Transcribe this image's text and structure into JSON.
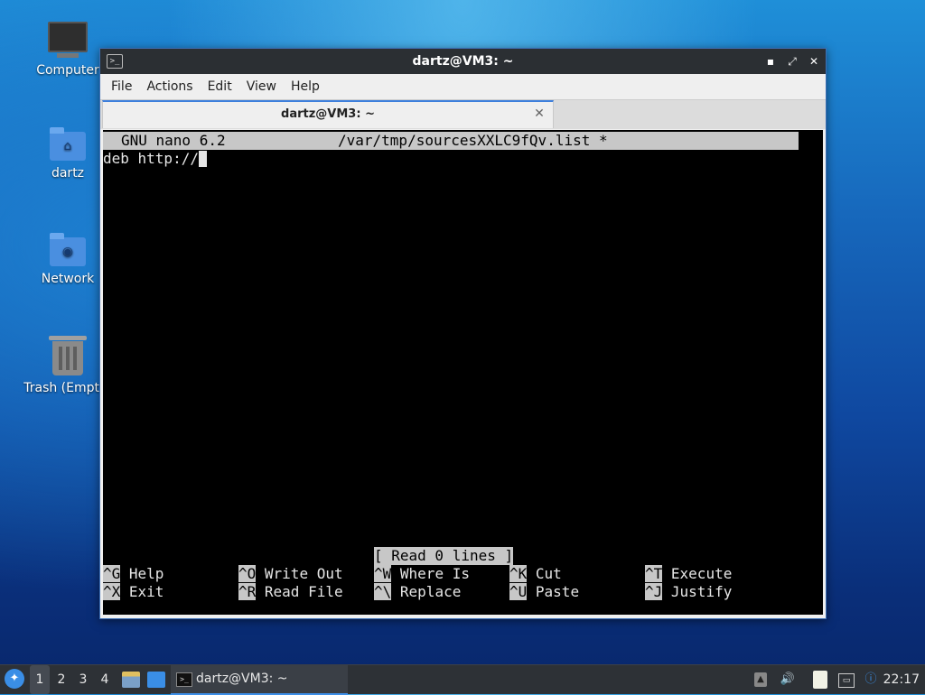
{
  "desktop": {
    "icons": [
      {
        "label": "Computer",
        "icon": "computer-icon"
      },
      {
        "label": "dartz",
        "icon": "home-folder-icon"
      },
      {
        "label": "Network",
        "icon": "network-folder-icon"
      },
      {
        "label": "Trash (Empty)",
        "icon": "trash-icon"
      }
    ]
  },
  "window": {
    "title": "dartz@VM3: ~",
    "menu": [
      "File",
      "Actions",
      "Edit",
      "View",
      "Help"
    ],
    "tab_title": "dartz@VM3: ~",
    "controls": {
      "minimize": "▪",
      "maximize": "⤢",
      "close": "✕"
    }
  },
  "nano": {
    "version": "GNU nano 6.2",
    "filename": "/var/tmp/sourcesXXLC9fQv.list *",
    "buffer_text": "deb http://",
    "status": "[ Read 0 lines ]",
    "shortcuts_row1": [
      {
        "key": "^G",
        "label": "Help"
      },
      {
        "key": "^O",
        "label": "Write Out"
      },
      {
        "key": "^W",
        "label": "Where Is"
      },
      {
        "key": "^K",
        "label": "Cut"
      },
      {
        "key": "^T",
        "label": "Execute"
      }
    ],
    "shortcuts_row2": [
      {
        "key": "^X",
        "label": "Exit"
      },
      {
        "key": "^R",
        "label": "Read File"
      },
      {
        "key": "^\\",
        "label": "Replace"
      },
      {
        "key": "^U",
        "label": "Paste"
      },
      {
        "key": "^J",
        "label": "Justify"
      }
    ]
  },
  "taskbar": {
    "workspaces": [
      "1",
      "2",
      "3",
      "4"
    ],
    "active_workspace": "1",
    "task_label": "dartz@VM3: ~",
    "clock": "22:17"
  },
  "colors": {
    "title_bar": "#2b2f33",
    "accent": "#3d7fdc",
    "terminal_bg": "#000000",
    "nano_bar": "#c7c7c7"
  }
}
